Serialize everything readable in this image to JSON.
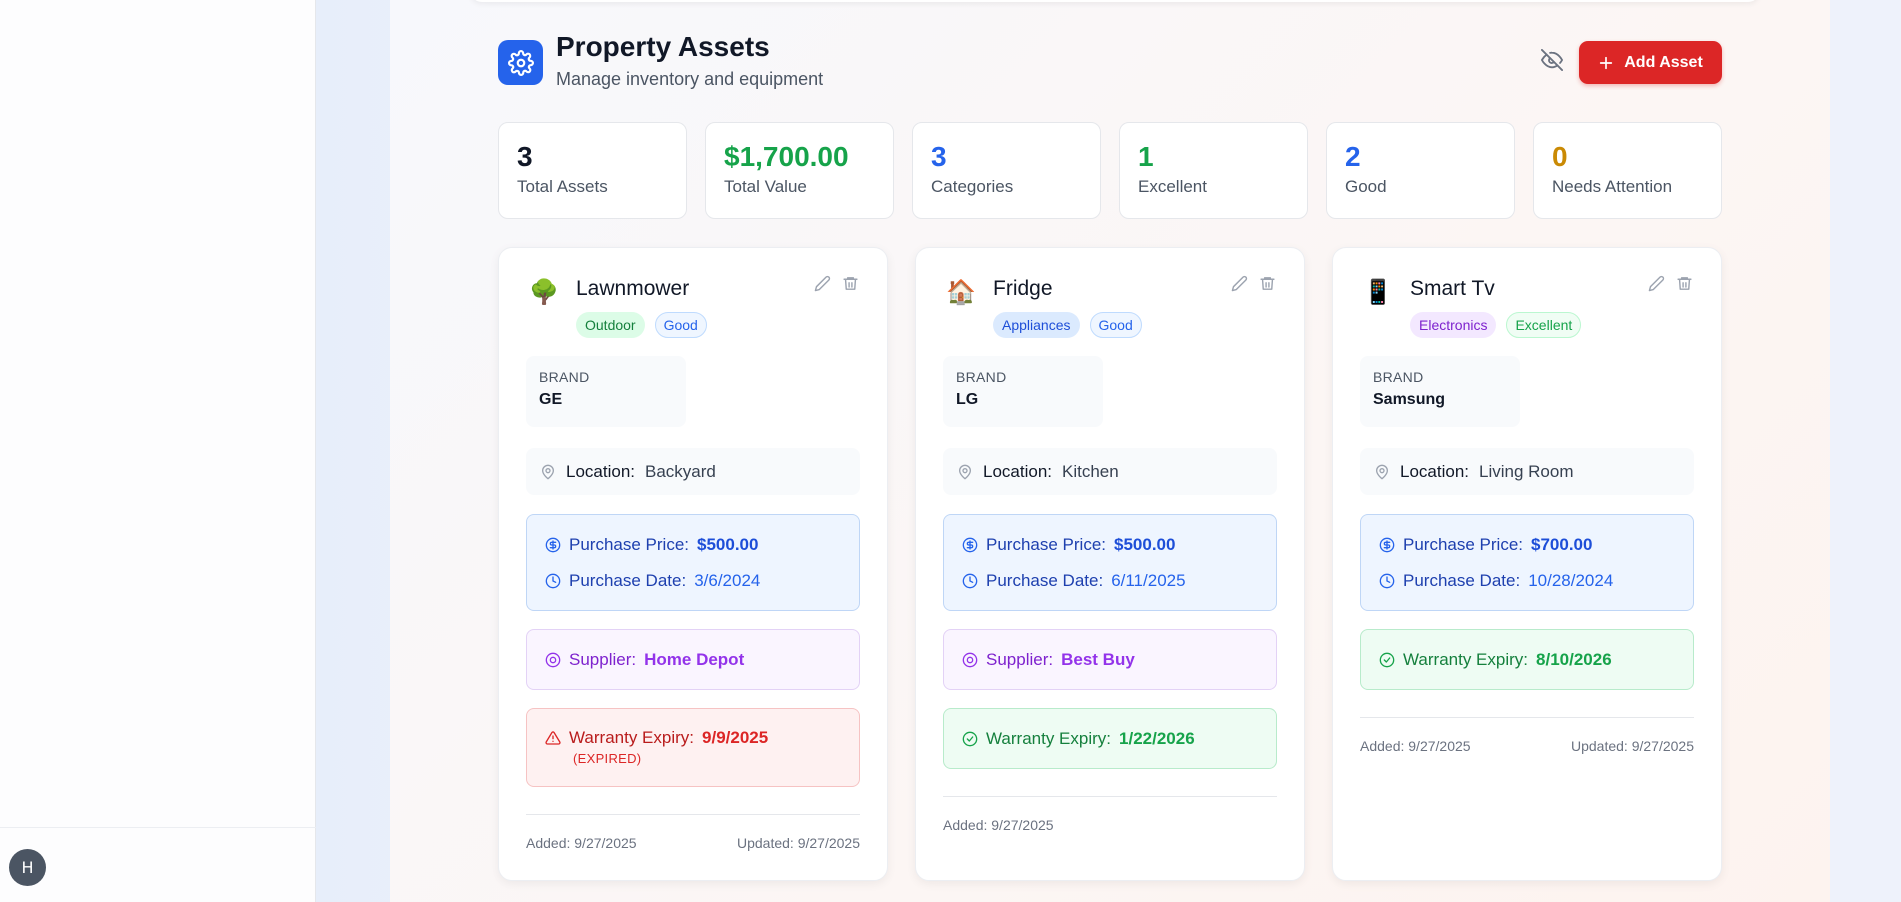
{
  "sidebar": {
    "avatar_initial": "H"
  },
  "header": {
    "title": "Property Assets",
    "subtitle": "Manage inventory and equipment",
    "add_button_label": "Add Asset"
  },
  "stats": [
    {
      "value": "3",
      "label": "Total Assets",
      "color": "#111827"
    },
    {
      "value": "$1,700.00",
      "label": "Total Value",
      "color": "#16a34a"
    },
    {
      "value": "3",
      "label": "Categories",
      "color": "#2563eb"
    },
    {
      "value": "1",
      "label": "Excellent",
      "color": "#16a34a"
    },
    {
      "value": "2",
      "label": "Good",
      "color": "#2563eb"
    },
    {
      "value": "0",
      "label": "Needs Attention",
      "color": "#ca8a04"
    }
  ],
  "labels": {
    "brand": "BRAND",
    "location": "Location:",
    "purchase_price": "Purchase Price:",
    "purchase_date": "Purchase Date:",
    "supplier": "Supplier:",
    "warranty_expiry": "Warranty Expiry:",
    "added": "Added:",
    "updated": "Updated:"
  },
  "cards": [
    {
      "emoji": "🌳",
      "name": "Lawnmower",
      "category": "Outdoor",
      "condition": "Good",
      "brand": "GE",
      "location": "Backyard",
      "purchase_price": "$500.00",
      "purchase_date": "3/6/2024",
      "supplier": "Home Depot",
      "warranty_expiry": "9/9/2025",
      "warranty_status": "(EXPIRED)",
      "added": "9/27/2025",
      "updated": "9/27/2025"
    },
    {
      "emoji": "🏠",
      "name": "Fridge",
      "category": "Appliances",
      "condition": "Good",
      "brand": "LG",
      "location": "Kitchen",
      "purchase_price": "$500.00",
      "purchase_date": "6/11/2025",
      "supplier": "Best Buy",
      "warranty_expiry": "1/22/2026",
      "added": "9/27/2025"
    },
    {
      "emoji": "📱",
      "name": "Smart Tv",
      "category": "Electronics",
      "condition": "Excellent",
      "brand": "Samsung",
      "location": "Living Room",
      "purchase_price": "$700.00",
      "purchase_date": "10/28/2024",
      "warranty_expiry": "8/10/2026",
      "added": "9/27/2025",
      "updated": "9/27/2025"
    }
  ],
  "colors": {
    "accent": "#2563eb",
    "danger": "#dc2626",
    "success": "#16a34a",
    "supplier": "#9333ea",
    "warning": "#ca8a04"
  }
}
